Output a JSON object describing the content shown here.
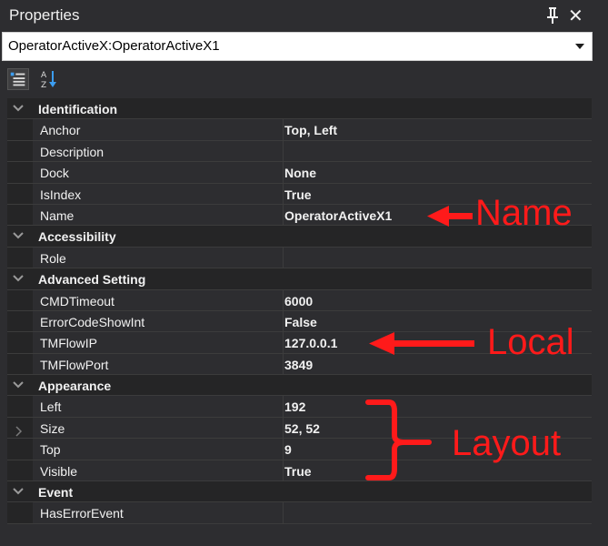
{
  "panel": {
    "title": "Properties",
    "combo_value": "OperatorActiveX:OperatorActiveX1"
  },
  "icons": {
    "pin": "pin-icon",
    "close": "close-icon",
    "categorized": "categorized-list-icon",
    "alphabetical": "sort-alphabetical-icon",
    "dropdown": "chevron-down-icon"
  },
  "close_glyph": "✕",
  "categories": [
    {
      "label": "Identification",
      "properties": [
        {
          "name": "Anchor",
          "value": "Top, Left"
        },
        {
          "name": "Description",
          "value": ""
        },
        {
          "name": "Dock",
          "value": "None"
        },
        {
          "name": "IsIndex",
          "value": "True"
        },
        {
          "name": "Name",
          "value": "OperatorActiveX1"
        }
      ]
    },
    {
      "label": "Accessibility",
      "properties": [
        {
          "name": "Role",
          "value": ""
        }
      ]
    },
    {
      "label": "Advanced Setting",
      "properties": [
        {
          "name": "CMDTimeout",
          "value": "6000"
        },
        {
          "name": "ErrorCodeShowInt",
          "value": "False"
        },
        {
          "name": "TMFlowIP",
          "value": "127.0.0.1"
        },
        {
          "name": "TMFlowPort",
          "value": "3849"
        }
      ]
    },
    {
      "label": "Appearance",
      "properties": [
        {
          "name": "Left",
          "value": "192"
        },
        {
          "name": "Size",
          "value": "52, 52"
        },
        {
          "name": "Top",
          "value": "9"
        },
        {
          "name": "Visible",
          "value": "True"
        }
      ]
    },
    {
      "label": "Event",
      "properties": [
        {
          "name": "HasErrorEvent",
          "value": ""
        }
      ]
    }
  ],
  "annotations": {
    "name": "Name",
    "local": "Local",
    "layout": "Layout",
    "color": "#ff1a1a"
  }
}
